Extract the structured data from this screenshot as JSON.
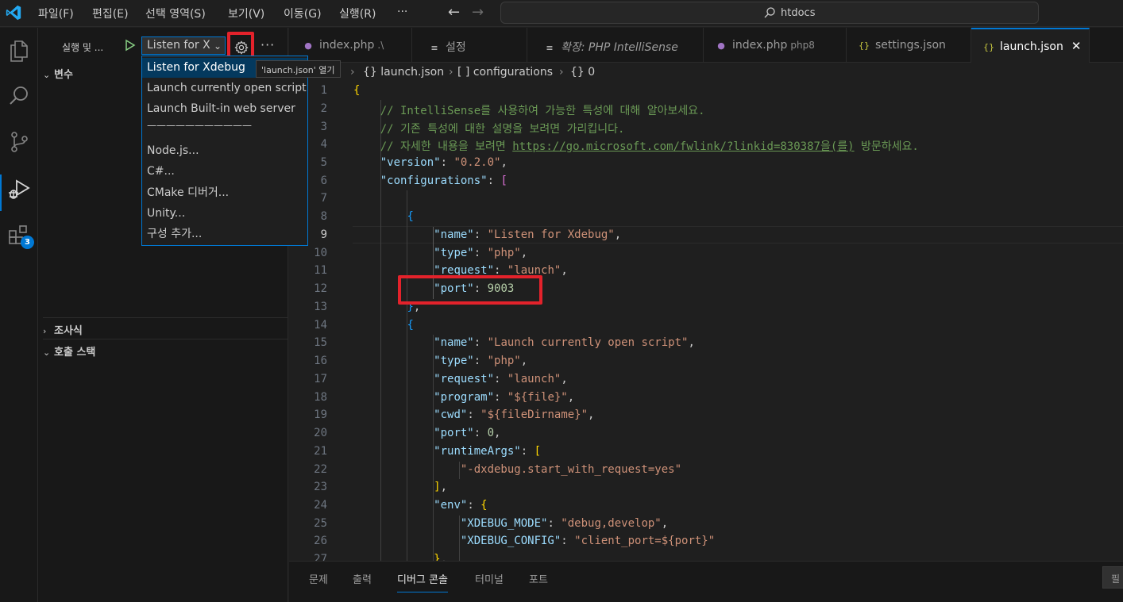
{
  "menubar": {
    "items": [
      "파일(F)",
      "편집(E)",
      "선택 영역(S)",
      "보기(V)",
      "이동(G)",
      "실행(R)",
      "···"
    ]
  },
  "command_center": {
    "text": "htdocs"
  },
  "activity_bar": {
    "extensions_badge": "3"
  },
  "sidebar": {
    "title": "실행 및 ...",
    "config_select": "Listen for X",
    "more": "···",
    "sections": [
      {
        "label": "변수",
        "expanded": true
      },
      {
        "label": "조사식",
        "expanded": false
      },
      {
        "label": "호출 스택",
        "expanded": true
      }
    ]
  },
  "dropdown": {
    "items": [
      "Listen for Xdebug",
      "Launch currently open script",
      "Launch Built-in web server",
      "———————————",
      "Node.js...",
      "C#...",
      "CMake 디버거...",
      "Unity...",
      "구성 추가..."
    ],
    "selected_index": 0
  },
  "tooltip": {
    "text": "'launch.json' 열기"
  },
  "tabs": [
    {
      "icon": "php-icon",
      "label": "index.php",
      "desc": ".\\",
      "active": false
    },
    {
      "icon": "settings-icon",
      "label": "설정",
      "desc": "",
      "active": false
    },
    {
      "icon": "extension-icon",
      "label": "확장: PHP IntelliSense",
      "desc": "",
      "active": false
    },
    {
      "icon": "php-icon",
      "label": "index.php",
      "desc": "php8",
      "active": false
    },
    {
      "icon": "json-icon",
      "label": "settings.json",
      "desc": "",
      "active": false
    },
    {
      "icon": "json-icon",
      "label": "launch.json",
      "desc": "",
      "active": true,
      "close": "✕"
    }
  ],
  "breadcrumb": [
    "{} launch.json",
    "[ ] configurations",
    "{} 0"
  ],
  "editor": {
    "current_line": 9,
    "line_numbers": [
      "1",
      "2",
      "3",
      "4",
      "5",
      "6",
      "7",
      "8",
      "9",
      "10",
      "11",
      "12",
      "13",
      "14",
      "15",
      "16",
      "17",
      "18",
      "19",
      "20",
      "21",
      "22",
      "23",
      "24",
      "25",
      "26",
      "27"
    ],
    "comment1": "// IntelliSense를 사용하여 가능한 특성에 대해 알아보세요.",
    "comment2": "// 기존 특성에 대한 설명을 보려면 가리킵니다.",
    "comment3_pre": "// 자세한 내용을 보려면 ",
    "comment3_link": "https://go.microsoft.com/fwlink/?linkid=830387을(를)",
    "comment3_post": " 방문하세요.",
    "version_key": "\"version\"",
    "version_val": "\"0.2.0\"",
    "configurations_key": "\"configurations\"",
    "c1": {
      "name_key": "\"name\"",
      "name_val": "\"Listen for Xdebug\"",
      "type_key": "\"type\"",
      "type_val": "\"php\"",
      "request_key": "\"request\"",
      "request_val": "\"launch\"",
      "port_key": "\"port\"",
      "port_val": "9003"
    },
    "c2": {
      "name_key": "\"name\"",
      "name_val": "\"Launch currently open script\"",
      "type_key": "\"type\"",
      "type_val": "\"php\"",
      "request_key": "\"request\"",
      "request_val": "\"launch\"",
      "program_key": "\"program\"",
      "program_val": "\"${file}\"",
      "cwd_key": "\"cwd\"",
      "cwd_val": "\"${fileDirname}\"",
      "port_key": "\"port\"",
      "port_val": "0",
      "runtime_key": "\"runtimeArgs\"",
      "runtime_arg": "\"-dxdebug.start_with_request=yes\"",
      "env_key": "\"env\"",
      "xmode_key": "\"XDEBUG_MODE\"",
      "xmode_val": "\"debug,develop\"",
      "xconfig_key": "\"XDEBUG_CONFIG\"",
      "xconfig_val": "\"client_port=${port}\""
    }
  },
  "panel": {
    "tabs": [
      "문제",
      "출력",
      "디버그 콘솔",
      "터미널",
      "포트"
    ],
    "active_index": 2,
    "filter": "필"
  },
  "colors": {
    "accent": "#0078d4",
    "highlight_box": "#e3222b",
    "json_key": "#9cdcfe",
    "json_string": "#ce9178",
    "comment": "#6a9955",
    "number": "#b5cea8"
  }
}
